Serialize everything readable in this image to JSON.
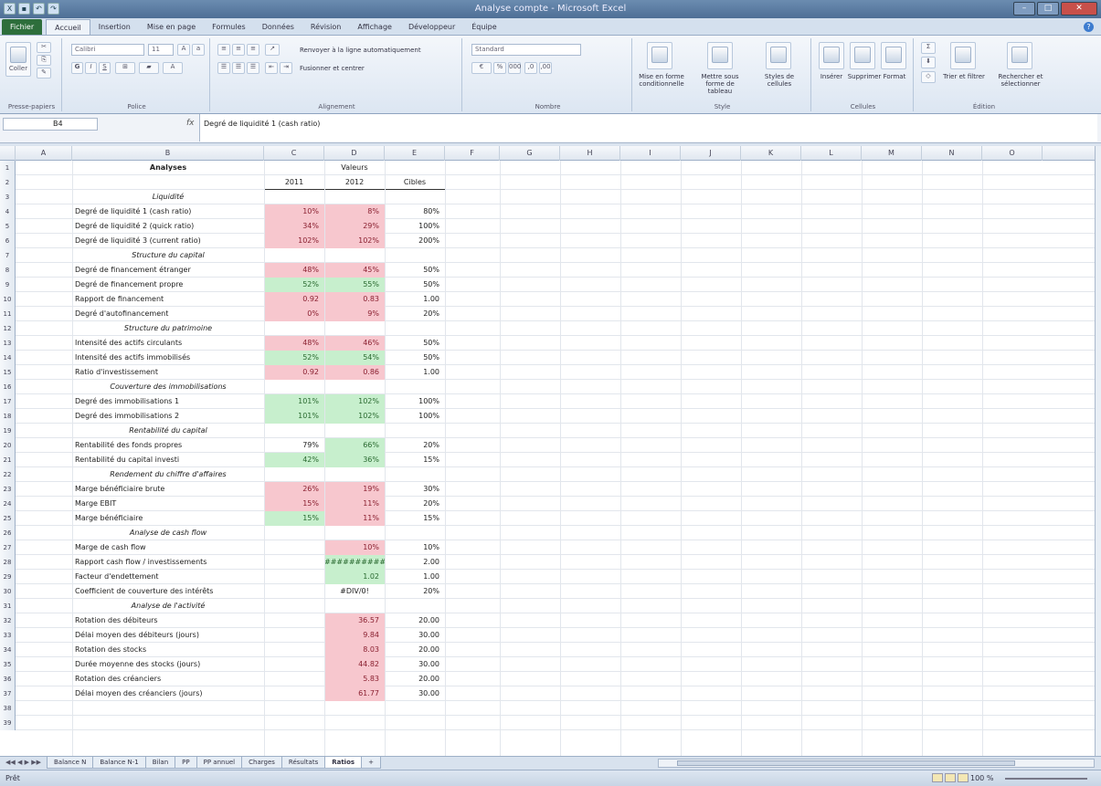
{
  "window": {
    "title": "Analyse compte - Microsoft Excel",
    "controls": [
      "–",
      "□",
      "✕"
    ]
  },
  "ribbon_tabs": [
    "Fichier",
    "Accueil",
    "Insertion",
    "Mise en page",
    "Formules",
    "Données",
    "Révision",
    "Affichage",
    "Développeur",
    "Équipe"
  ],
  "ribbon": {
    "groups": [
      "Presse-papiers",
      "Police",
      "Alignement",
      "Nombre",
      "Style",
      "Cellules",
      "Édition"
    ],
    "paste_label": "Coller",
    "font_name": "Calibri",
    "font_size": "11",
    "wrap_text": "Renvoyer à la ligne automatiquement",
    "merge_center": "Fusionner et centrer",
    "number_format": "Standard",
    "style_buttons": [
      "Mise en forme conditionnelle",
      "Mettre sous forme de tableau",
      "Styles de cellules"
    ],
    "cell_buttons": [
      "Insérer",
      "Supprimer",
      "Format"
    ],
    "edit_buttons": [
      "Trier et filtrer",
      "Rechercher et sélectionner"
    ]
  },
  "formula_bar": {
    "name_box": "B4",
    "fx": "fx",
    "value": "Degré de liquidité 1 (cash ratio)"
  },
  "columns": [
    "A",
    "B",
    "C",
    "D",
    "E",
    "F",
    "G",
    "H",
    "I",
    "J",
    "K",
    "L",
    "M",
    "N",
    "O"
  ],
  "header": {
    "analyses": "Analyses",
    "valeurs": "Valeurs",
    "y2011": "2011",
    "y2012": "2012",
    "cibles": "Cibles"
  },
  "rows": [
    {
      "n": "1"
    },
    {
      "n": "2"
    },
    {
      "n": "3",
      "section": "Liquidité"
    },
    {
      "n": "4",
      "label": "Degré de liquidité 1 (cash ratio)",
      "c": "10%",
      "cs": "red",
      "d": "8%",
      "ds": "red",
      "e": "80%"
    },
    {
      "n": "5",
      "label": "Degré de liquidité 2 (quick ratio)",
      "c": "34%",
      "cs": "red",
      "d": "29%",
      "ds": "red",
      "e": "100%"
    },
    {
      "n": "6",
      "label": "Degré de liquidité 3 (current ratio)",
      "c": "102%",
      "cs": "red",
      "d": "102%",
      "ds": "red",
      "e": "200%"
    },
    {
      "n": "7",
      "section": "Structure du capital"
    },
    {
      "n": "8",
      "label": "Degré de financement étranger",
      "c": "48%",
      "cs": "red",
      "d": "45%",
      "ds": "red",
      "e": "50%"
    },
    {
      "n": "9",
      "label": "Degré de financement propre",
      "c": "52%",
      "cs": "green",
      "d": "55%",
      "ds": "green",
      "e": "50%"
    },
    {
      "n": "10",
      "label": "Rapport de financement",
      "c": "0.92",
      "cs": "red",
      "d": "0.83",
      "ds": "red",
      "e": "1.00"
    },
    {
      "n": "11",
      "label": "Degré d'autofinancement",
      "c": "0%",
      "cs": "red",
      "d": "9%",
      "ds": "red",
      "e": "20%"
    },
    {
      "n": "12",
      "section": "Structure du patrimoine"
    },
    {
      "n": "13",
      "label": "Intensité des actifs circulants",
      "c": "48%",
      "cs": "red",
      "d": "46%",
      "ds": "red",
      "e": "50%"
    },
    {
      "n": "14",
      "label": "Intensité des actifs immobilisés",
      "c": "52%",
      "cs": "green",
      "d": "54%",
      "ds": "green",
      "e": "50%"
    },
    {
      "n": "15",
      "label": "Ratio d'investissement",
      "c": "0.92",
      "cs": "red",
      "d": "0.86",
      "ds": "red",
      "e": "1.00"
    },
    {
      "n": "16",
      "section": "Couverture des immobilisations"
    },
    {
      "n": "17",
      "label": "Degré des immobilisations 1",
      "c": "101%",
      "cs": "green",
      "d": "102%",
      "ds": "green",
      "e": "100%"
    },
    {
      "n": "18",
      "label": "Degré des immobilisations 2",
      "c": "101%",
      "cs": "green",
      "d": "102%",
      "ds": "green",
      "e": "100%"
    },
    {
      "n": "19",
      "section": "Rentabilité du capital"
    },
    {
      "n": "20",
      "label": "Rentabilité des fonds propres",
      "c": "79%",
      "cs": "",
      "d": "66%",
      "ds": "green",
      "e": "20%"
    },
    {
      "n": "21",
      "label": "Rentabilité du capital investi",
      "c": "42%",
      "cs": "green",
      "d": "36%",
      "ds": "green",
      "e": "15%"
    },
    {
      "n": "22",
      "section": "Rendement du chiffre d'affaires"
    },
    {
      "n": "23",
      "label": "Marge bénéficiaire brute",
      "c": "26%",
      "cs": "red",
      "d": "19%",
      "ds": "red",
      "e": "30%"
    },
    {
      "n": "24",
      "label": "Marge EBIT",
      "c": "15%",
      "cs": "red",
      "d": "11%",
      "ds": "red",
      "e": "20%"
    },
    {
      "n": "25",
      "label": "Marge bénéficiaire",
      "c": "15%",
      "cs": "green",
      "d": "11%",
      "ds": "red",
      "e": "15%"
    },
    {
      "n": "26",
      "section": "Analyse de cash flow"
    },
    {
      "n": "27",
      "label": "Marge de cash flow",
      "c": "",
      "cs": "",
      "d": "10%",
      "ds": "red",
      "e": "10%"
    },
    {
      "n": "28",
      "label": "Rapport cash flow / investissements",
      "c": "",
      "cs": "",
      "d": "##########",
      "ds": "green",
      "e": "2.00"
    },
    {
      "n": "29",
      "label": "Facteur d'endettement",
      "c": "",
      "cs": "",
      "d": "1.02",
      "ds": "green",
      "e": "1.00"
    },
    {
      "n": "30",
      "label": "Coefficient de couverture des intérêts",
      "c": "",
      "cs": "",
      "d": "#DIV/0!",
      "ds": "",
      "e": "20%"
    },
    {
      "n": "31",
      "section": "Analyse de l'activité"
    },
    {
      "n": "32",
      "label": "Rotation des débiteurs",
      "c": "",
      "cs": "",
      "d": "36.57",
      "ds": "red",
      "e": "20.00"
    },
    {
      "n": "33",
      "label": "Délai moyen des débiteurs (jours)",
      "c": "",
      "cs": "",
      "d": "9.84",
      "ds": "red",
      "e": "30.00"
    },
    {
      "n": "34",
      "label": "Rotation des stocks",
      "c": "",
      "cs": "",
      "d": "8.03",
      "ds": "red",
      "e": "20.00"
    },
    {
      "n": "35",
      "label": "Durée moyenne des stocks (jours)",
      "c": "",
      "cs": "",
      "d": "44.82",
      "ds": "red",
      "e": "30.00"
    },
    {
      "n": "36",
      "label": "Rotation des créanciers",
      "c": "",
      "cs": "",
      "d": "5.83",
      "ds": "red",
      "e": "20.00"
    },
    {
      "n": "37",
      "label": "Délai moyen des créanciers (jours)",
      "c": "",
      "cs": "",
      "d": "61.77",
      "ds": "red",
      "e": "30.00"
    },
    {
      "n": "38"
    },
    {
      "n": "39"
    }
  ],
  "sheet_tabs": [
    "Balance N",
    "Balance N-1",
    "Bilan",
    "PP",
    "PP annuel",
    "Charges",
    "Résultats",
    "Ratios"
  ],
  "active_sheet": "Ratios",
  "status": {
    "ready": "Prêt",
    "zoom": "100 %"
  },
  "colors": {
    "red_fill": "#f7c7ce",
    "green_fill": "#c7efcd",
    "file_tab": "#2d6e3b"
  }
}
